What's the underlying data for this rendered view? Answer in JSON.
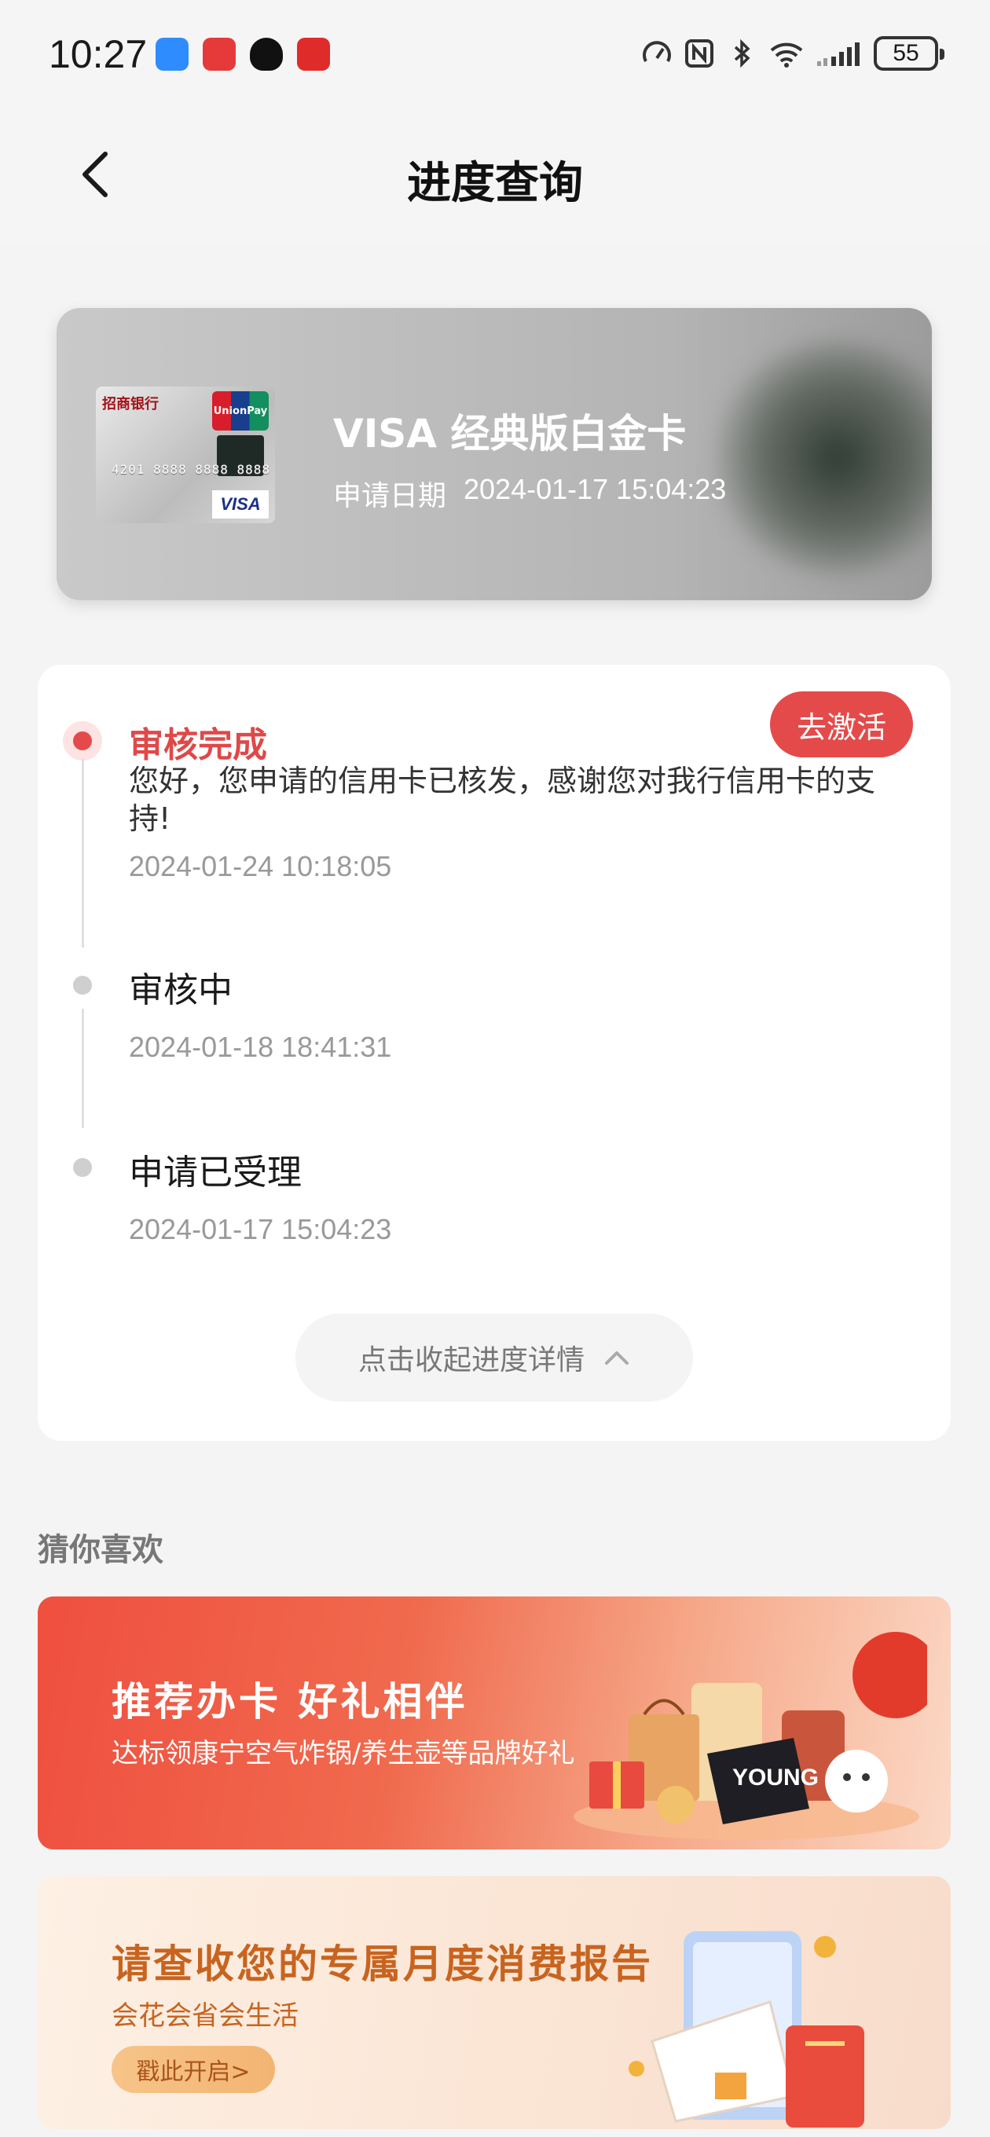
{
  "status_bar": {
    "time": "10:27",
    "battery": "55",
    "icons": [
      "speed-icon",
      "nfc-icon",
      "bluetooth-icon",
      "wifi-icon",
      "signal-icon"
    ]
  },
  "header": {
    "title": "进度查询",
    "back_icon": "chevron-left-icon"
  },
  "card": {
    "name": "VISA 经典版白金卡",
    "date_label": "申请日期",
    "date_value": "2024-01-17 15:04:23",
    "thumb": {
      "bank": "招商银行",
      "network": "UnionPay",
      "brand": "VISA",
      "number": "4201 8888 8888 8888"
    }
  },
  "progress": {
    "action_label": "去激活",
    "steps": [
      {
        "title": "审核完成",
        "description": "您好，您申请的信用卡已核发，感谢您对我行信用卡的支持!",
        "time": "2024-01-24 10:18:05"
      },
      {
        "title": "审核中",
        "time": "2024-01-18 18:41:31"
      },
      {
        "title": "申请已受理",
        "time": "2024-01-17 15:04:23"
      }
    ],
    "collapse_label": "点击收起进度详情"
  },
  "recommend": {
    "title": "猜你喜欢",
    "banners": [
      {
        "title": "推荐办卡 好礼相伴",
        "subtitle": "达标领康宁空气炸锅/养生壶等品牌好礼",
        "art_text": "YOUNG"
      },
      {
        "title": "请查收您的专属月度消费报告",
        "subtitle": "会花会省会生活",
        "button": "戳此开启>"
      }
    ]
  },
  "colors": {
    "accent": "#e54a4a",
    "banner_orange": "#c8641f"
  }
}
